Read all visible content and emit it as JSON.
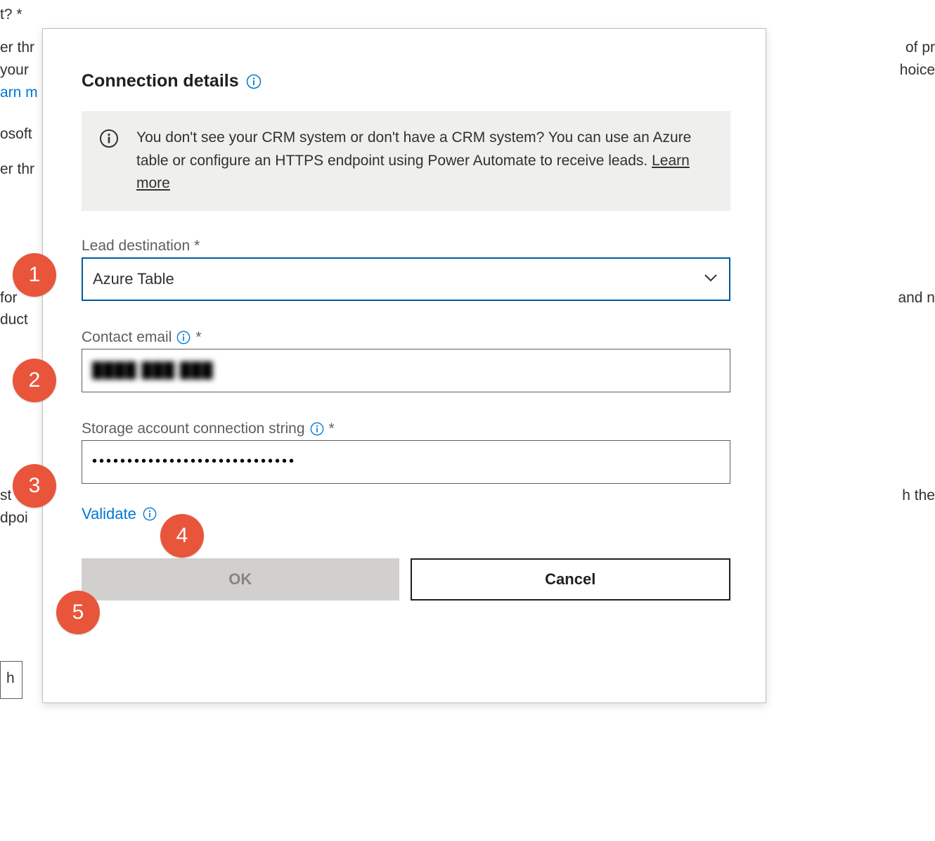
{
  "background": {
    "frag_t_star": "t? *",
    "frag_er_thr1": "er thr",
    "frag_your": " your",
    "frag_arn_m": "arn m",
    "frag_osoft": "osoft",
    "frag_er_thr2": "er thr",
    "frag_for": "for",
    "frag_duct": "duct",
    "frag_st": "st",
    "frag_dpoi": "dpoi",
    "frag_h": "h",
    "frag_of_pr": " of pr",
    "frag_hoice": "hoice",
    "frag_and_n": "and n",
    "frag_h_the": "h the"
  },
  "dialog": {
    "title": "Connection details",
    "banner_text_1": "You don't see your CRM system or don't have a CRM system? You can use an Azure table or configure an HTTPS endpoint using Power Automate to receive leads. ",
    "banner_learn_more": "Learn more",
    "lead_dest_label": "Lead destination",
    "lead_dest_required": "*",
    "lead_dest_value": "Azure Table",
    "contact_email_label": "Contact email",
    "contact_email_required": "*",
    "contact_email_value": "████ ███ ███",
    "storage_label": "Storage account connection string",
    "storage_required": "*",
    "storage_value": "•••••••••••••••••••••••••••••",
    "validate_label": "Validate",
    "ok_label": "OK",
    "cancel_label": "Cancel"
  },
  "callouts": {
    "c1": "1",
    "c2": "2",
    "c3": "3",
    "c4": "4",
    "c5": "5"
  }
}
